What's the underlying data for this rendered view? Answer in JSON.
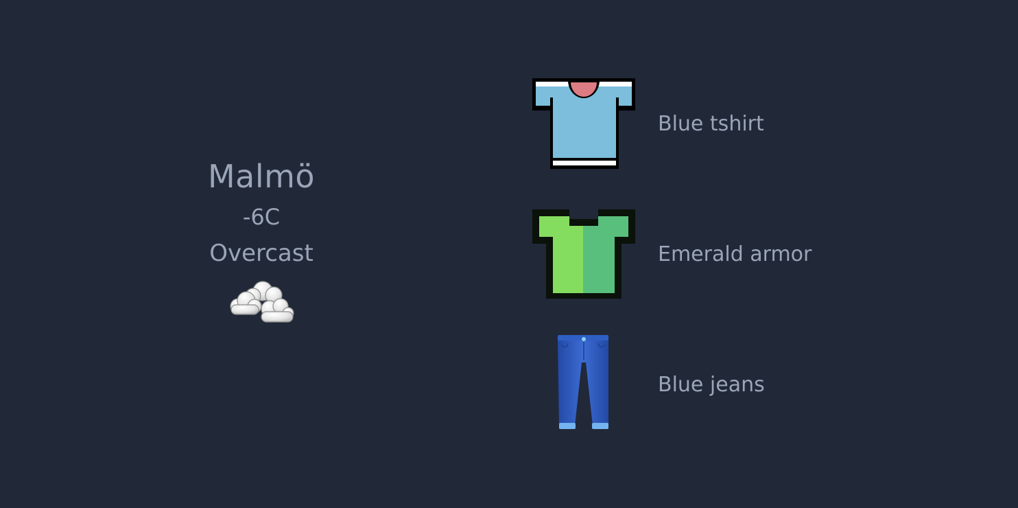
{
  "weather": {
    "city": "Malmö",
    "temperature": "-6C",
    "condition": "Overcast",
    "icon": "cloud-icon"
  },
  "outfit": {
    "items": [
      {
        "label": "Blue tshirt",
        "icon": "tshirt-icon"
      },
      {
        "label": "Emerald armor",
        "icon": "armor-icon"
      },
      {
        "label": "Blue jeans",
        "icon": "jeans-icon"
      }
    ]
  },
  "colors": {
    "background": "#212838",
    "text": "#9aa5b8"
  }
}
